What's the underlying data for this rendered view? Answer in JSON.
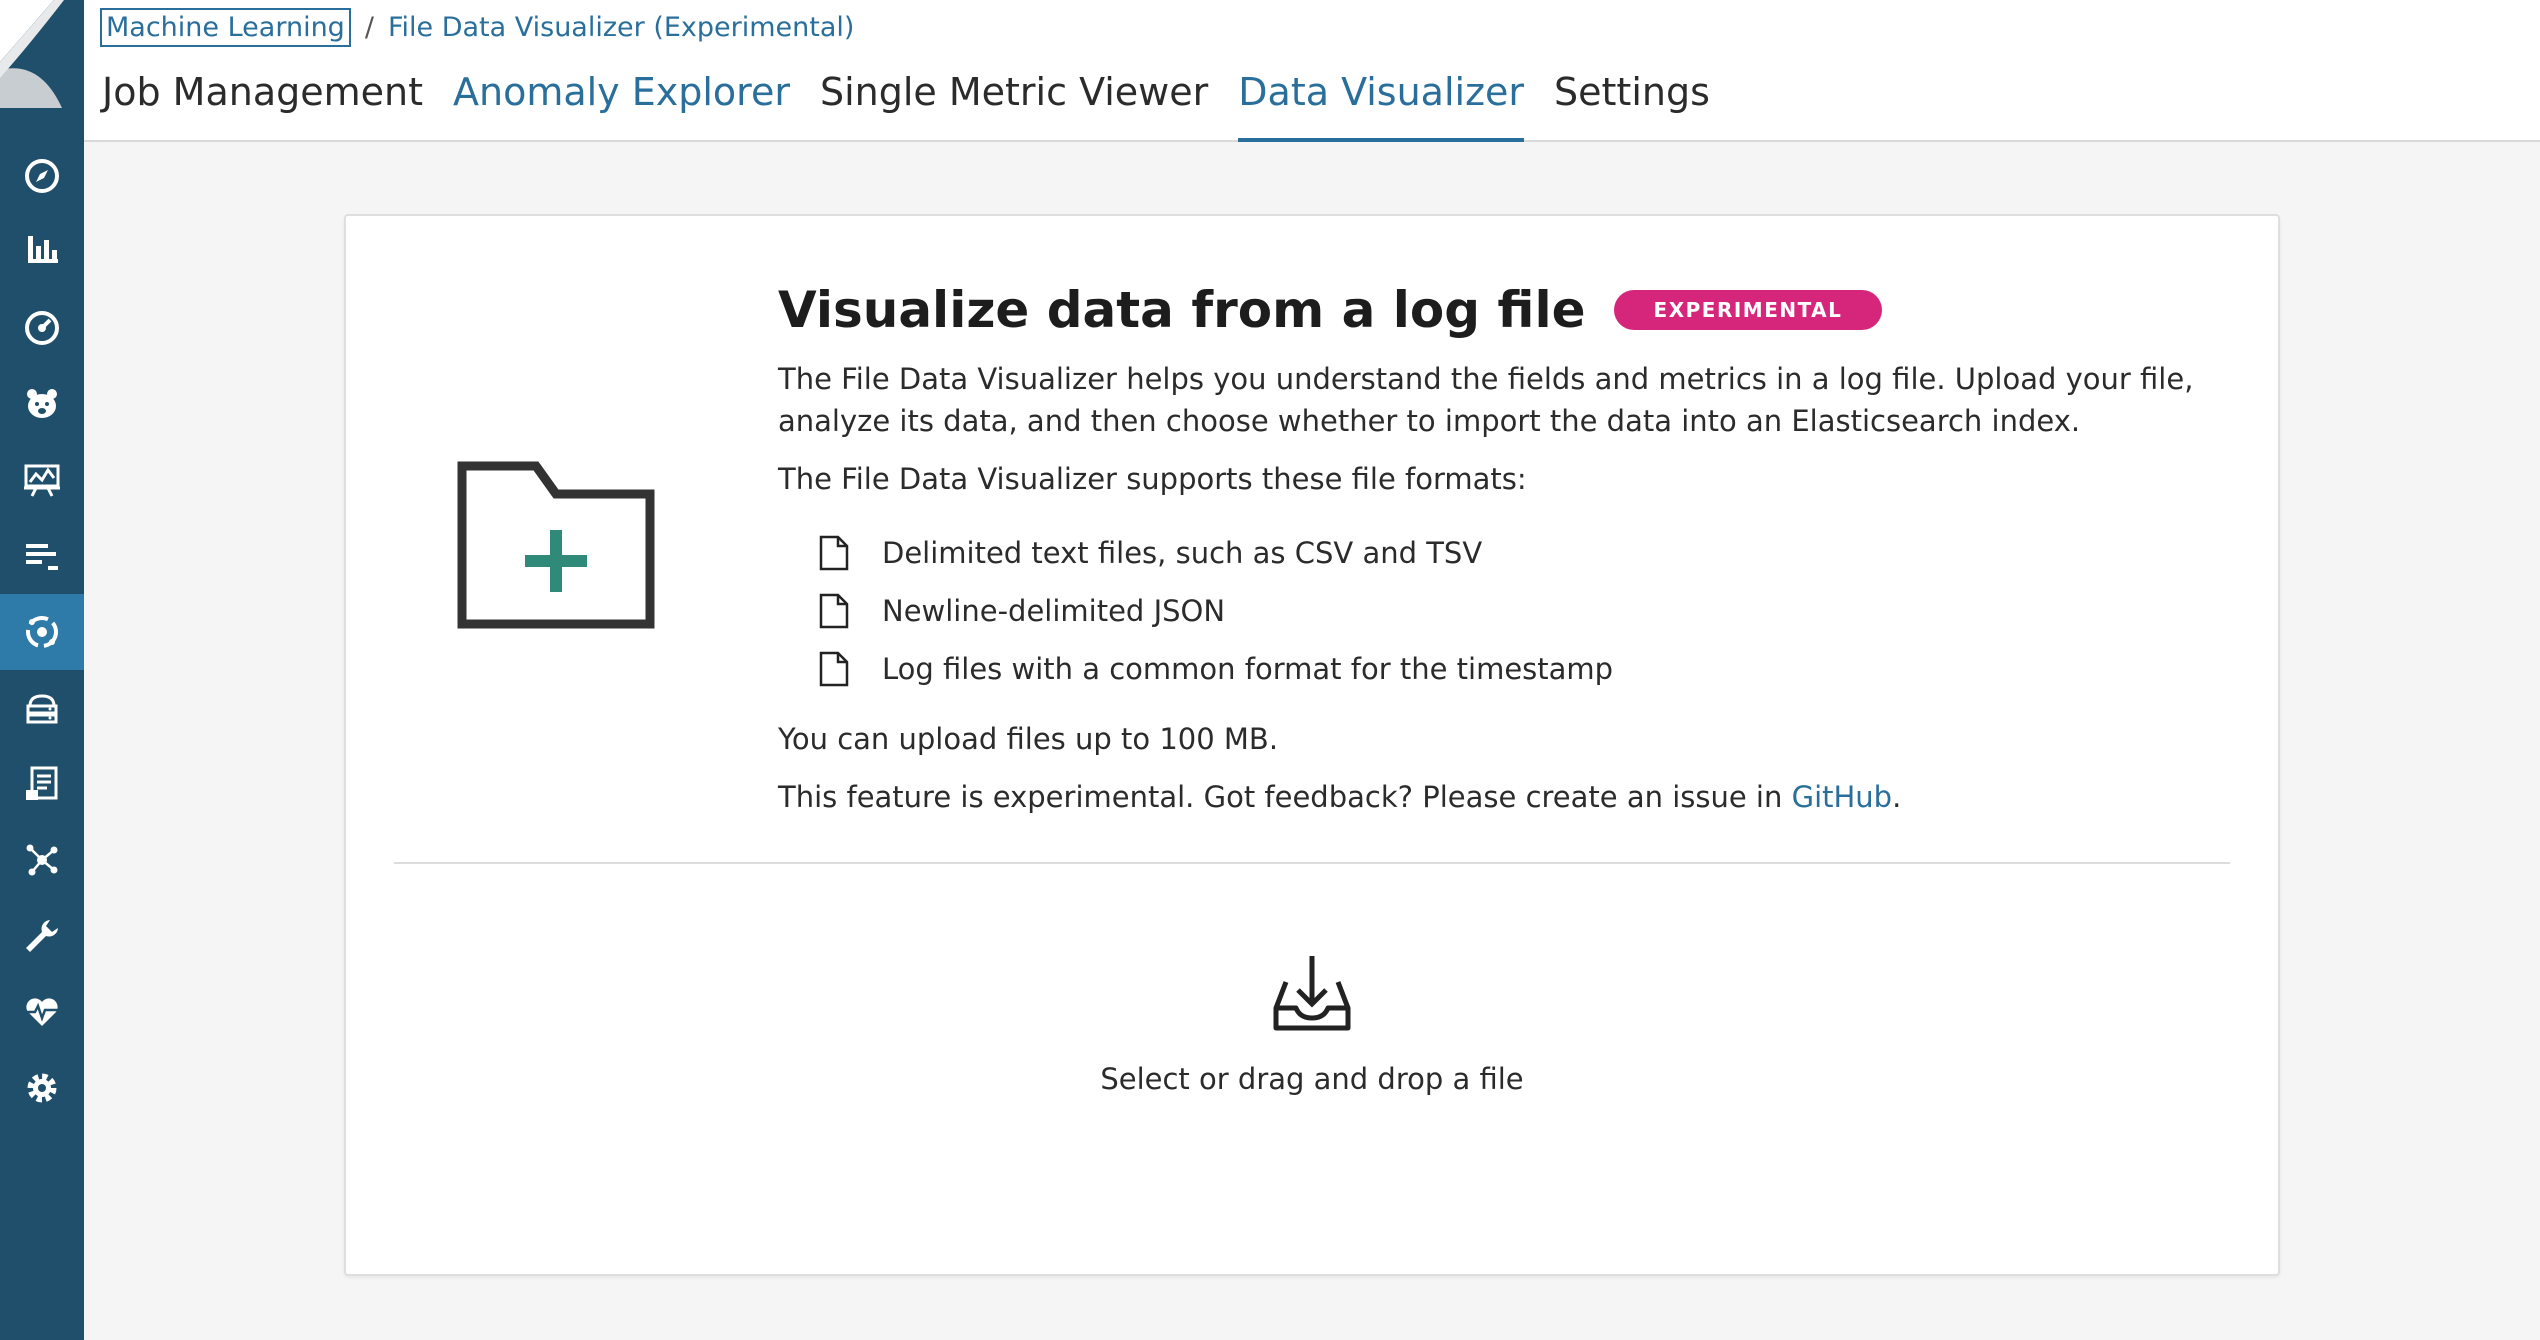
{
  "breadcrumbs": {
    "root": "Machine Learning",
    "separator": "/",
    "current": "File Data Visualizer (Experimental)"
  },
  "tabs": [
    {
      "label": "Job Management",
      "state": "default"
    },
    {
      "label": "Anomaly Explorer",
      "state": "link"
    },
    {
      "label": "Single Metric Viewer",
      "state": "default"
    },
    {
      "label": "Data Visualizer",
      "state": "active"
    },
    {
      "label": "Settings",
      "state": "default"
    }
  ],
  "sidebar": {
    "items": [
      {
        "icon": "compass-icon"
      },
      {
        "icon": "bar-chart-icon"
      },
      {
        "icon": "dashboard-gauge-icon"
      },
      {
        "icon": "bear-icon"
      },
      {
        "icon": "presentation-icon"
      },
      {
        "icon": "logs-icon"
      },
      {
        "icon": "machine-learning-icon",
        "active": true
      },
      {
        "icon": "infrastructure-icon"
      },
      {
        "icon": "dev-tools-document-icon"
      },
      {
        "icon": "graph-network-icon"
      },
      {
        "icon": "wrench-icon"
      },
      {
        "icon": "heart-monitoring-icon"
      },
      {
        "icon": "gear-icon"
      }
    ]
  },
  "panel": {
    "title": "Visualize data from a log file",
    "badge": "EXPERIMENTAL",
    "description": "The File Data Visualizer helps you understand the fields and metrics in a log file. Upload your file, analyze its data, and then choose whether to import the data into an Elasticsearch index.",
    "formats_intro": "The File Data Visualizer supports these file formats:",
    "formats": [
      "Delimited text files, such as CSV and TSV",
      "Newline-delimited JSON",
      "Log files with a common format for the timestamp"
    ],
    "size_limit": "You can upload files up to 100 MB.",
    "feedback_prefix": "This feature is experimental. Got feedback? Please create an issue in ",
    "feedback_link": "GitHub",
    "feedback_suffix": ".",
    "drop_text": "Select or drag and drop a file"
  },
  "colors": {
    "sidebar": "#1f4f6b",
    "sidebar_active": "#2e7aa8",
    "link": "#2a6f9b",
    "badge": "#d6267c",
    "folder_plus": "#2f8a7a"
  }
}
